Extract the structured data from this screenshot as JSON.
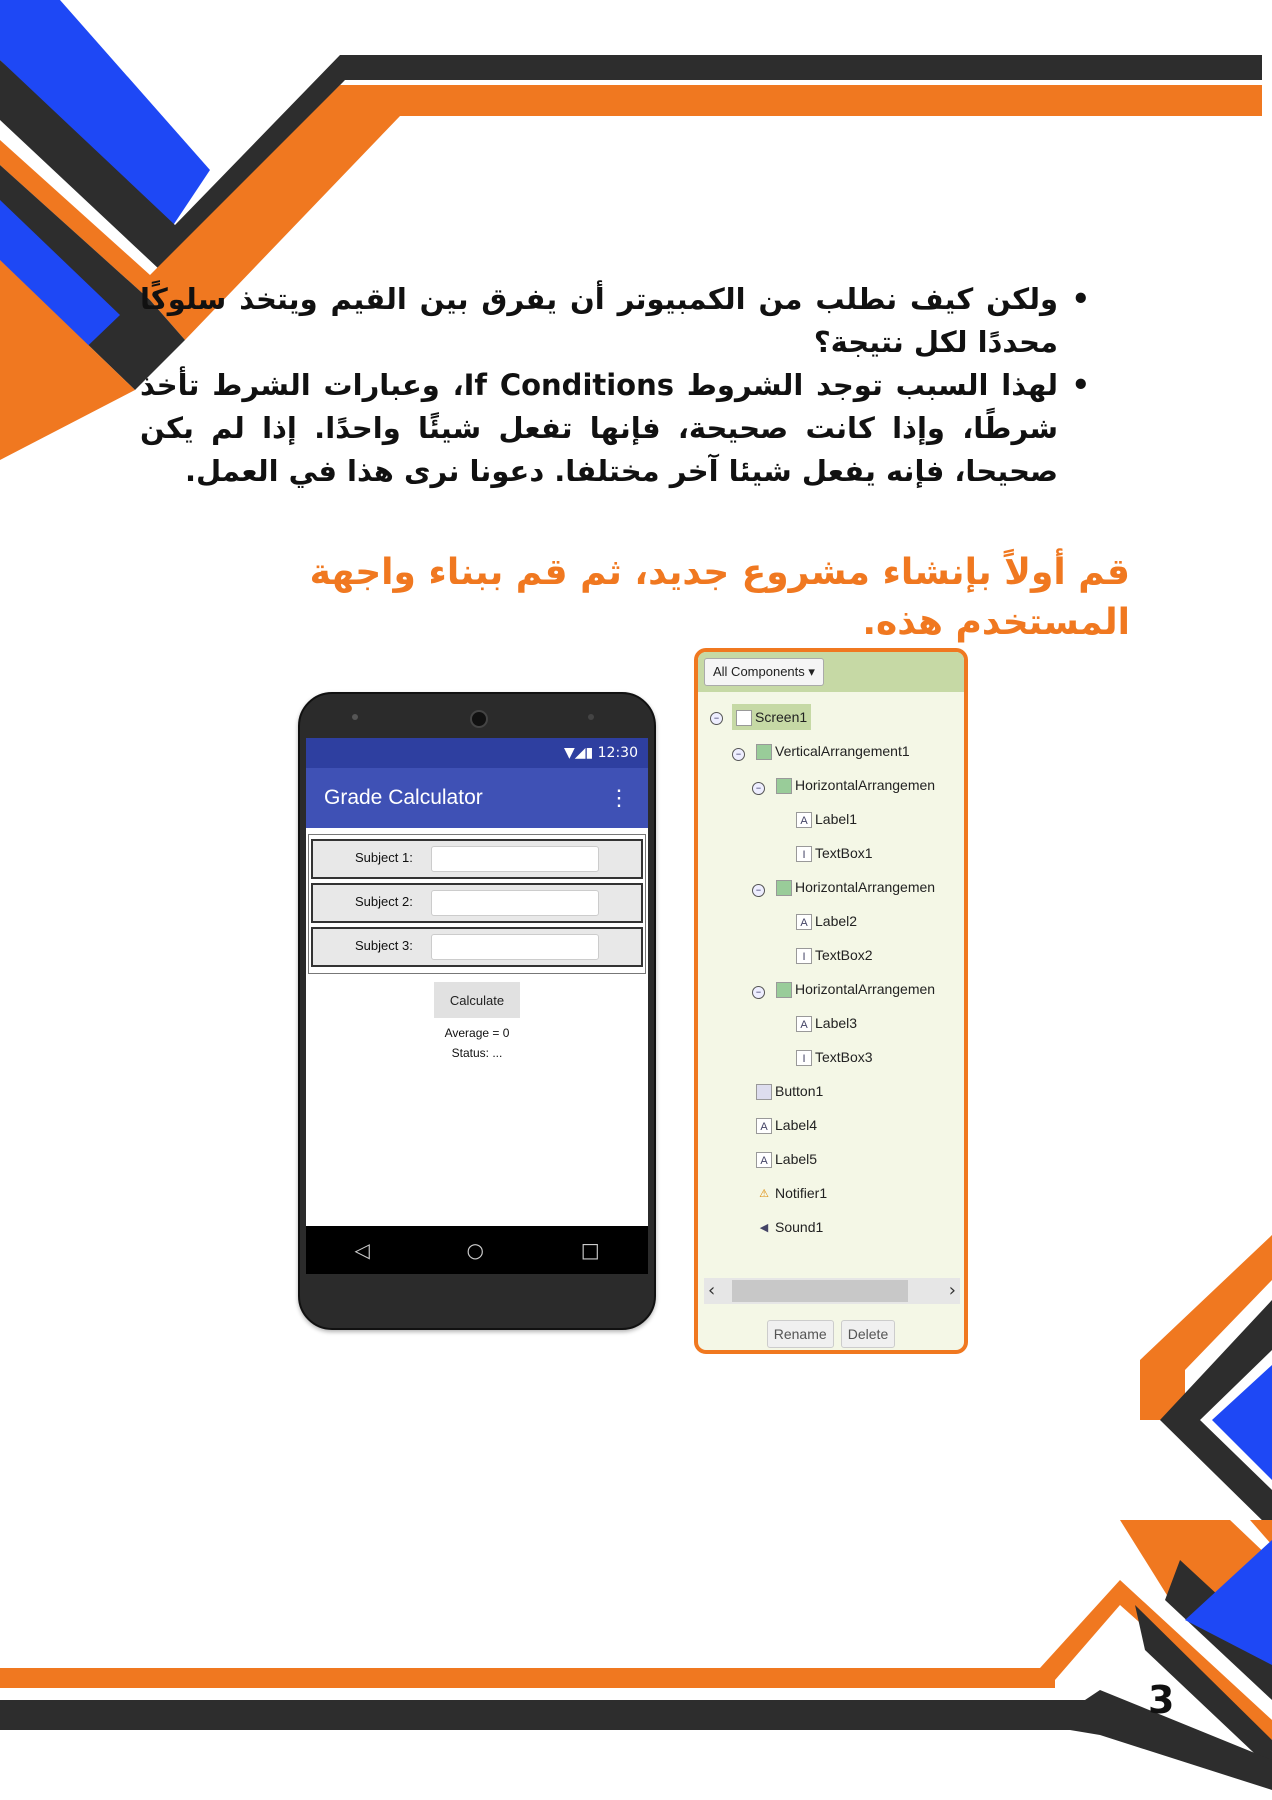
{
  "page": {
    "bullet1": "ولكن كيف نطلب من الكمبيوتر أن يفرق بين القيم ويتخذ سلوكًا محددًا لكل نتيجة؟",
    "bullet2": "لهذا السبب توجد الشروط If Conditions، وعبارات الشرط تأخذ شرطًا، وإذا كانت صحيحة، فإنها تفعل شيئًا واحدًا. إذا لم يكن صحيحا، فإنه يفعل شيئا آخر مختلفا. دعونا نرى هذا في العمل.",
    "instruction": "قم أولاً بإنشاء مشروع جديد، ثم قم ببناء واجهة المستخدم هذه.",
    "page_number": "3"
  },
  "phone": {
    "status_time": "12:30",
    "app_title": "Grade Calculator",
    "subjects": [
      "Subject 1:",
      "Subject 2:",
      "Subject 3:"
    ],
    "calculate_label": "Calculate",
    "average_text": "Average = 0",
    "status_text": "Status: ..."
  },
  "components": {
    "dropdown_label": "All Components",
    "tree": [
      {
        "label": "Screen1",
        "icon": "screen-icon"
      },
      {
        "label": "VerticalArrangement1",
        "icon": "vertical-arrangement-icon"
      },
      {
        "label": "HorizontalArrangemen",
        "icon": "horizontal-arrangement-icon"
      },
      {
        "label": "Label1",
        "icon": "label-icon"
      },
      {
        "label": "TextBox1",
        "icon": "textbox-icon"
      },
      {
        "label": "HorizontalArrangemen",
        "icon": "horizontal-arrangement-icon"
      },
      {
        "label": "Label2",
        "icon": "label-icon"
      },
      {
        "label": "TextBox2",
        "icon": "textbox-icon"
      },
      {
        "label": "HorizontalArrangemen",
        "icon": "horizontal-arrangement-icon"
      },
      {
        "label": "Label3",
        "icon": "label-icon"
      },
      {
        "label": "TextBox3",
        "icon": "textbox-icon"
      },
      {
        "label": "Button1",
        "icon": "button-icon"
      },
      {
        "label": "Label4",
        "icon": "label-icon"
      },
      {
        "label": "Label5",
        "icon": "label-icon"
      },
      {
        "label": "Notifier1",
        "icon": "notifier-icon"
      },
      {
        "label": "Sound1",
        "icon": "sound-icon"
      }
    ],
    "rename_label": "Rename",
    "delete_label": "Delete"
  },
  "colors": {
    "orange": "#f07820",
    "blue": "#1e48f5",
    "dark": "#2d2d2d",
    "app_bar": "#3f51b5"
  }
}
